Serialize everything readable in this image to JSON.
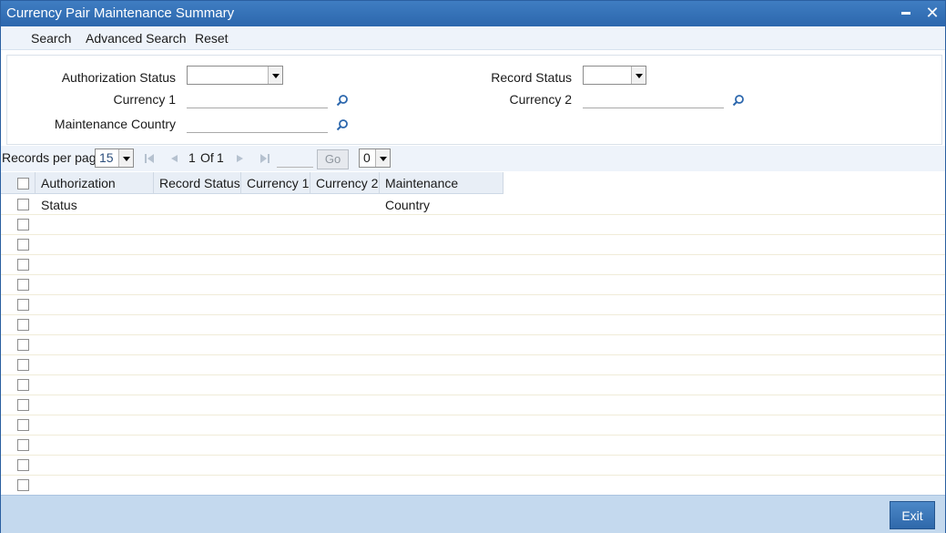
{
  "window": {
    "title": "Currency Pair Maintenance Summary"
  },
  "toolbar": {
    "search": "Search",
    "advanced_search": "Advanced Search",
    "reset": "Reset"
  },
  "criteria": {
    "authorization_status_label": "Authorization Status",
    "authorization_status_value": "",
    "record_status_label": "Record Status",
    "record_status_value": "",
    "currency1_label": "Currency 1",
    "currency1_value": "",
    "currency2_label": "Currency 2",
    "currency2_value": "",
    "maintenance_country_label": "Maintenance Country",
    "maintenance_country_value": ""
  },
  "pager": {
    "records_per_page_label": "Records per page",
    "records_per_page_value": "15",
    "current_page": "1",
    "of_label": "Of",
    "total_pages": "1",
    "go_label": "Go",
    "page_input_value": "",
    "count_value": "0"
  },
  "grid": {
    "columns": [
      "Authorization Status",
      "Record Status",
      "Currency 1",
      "Currency 2",
      "Maintenance Country"
    ],
    "empty_row_count": 15
  },
  "footer": {
    "exit_label": "Exit"
  },
  "colors": {
    "titlebar": "#2c67ad",
    "footer": "#c4d9ee",
    "toolbar": "#eef3fa"
  },
  "icons": [
    "minimize-icon",
    "close-icon",
    "search-lens-icon",
    "first-page-icon",
    "prev-page-icon",
    "next-page-icon",
    "last-page-icon",
    "dropdown-arrow-icon"
  ]
}
